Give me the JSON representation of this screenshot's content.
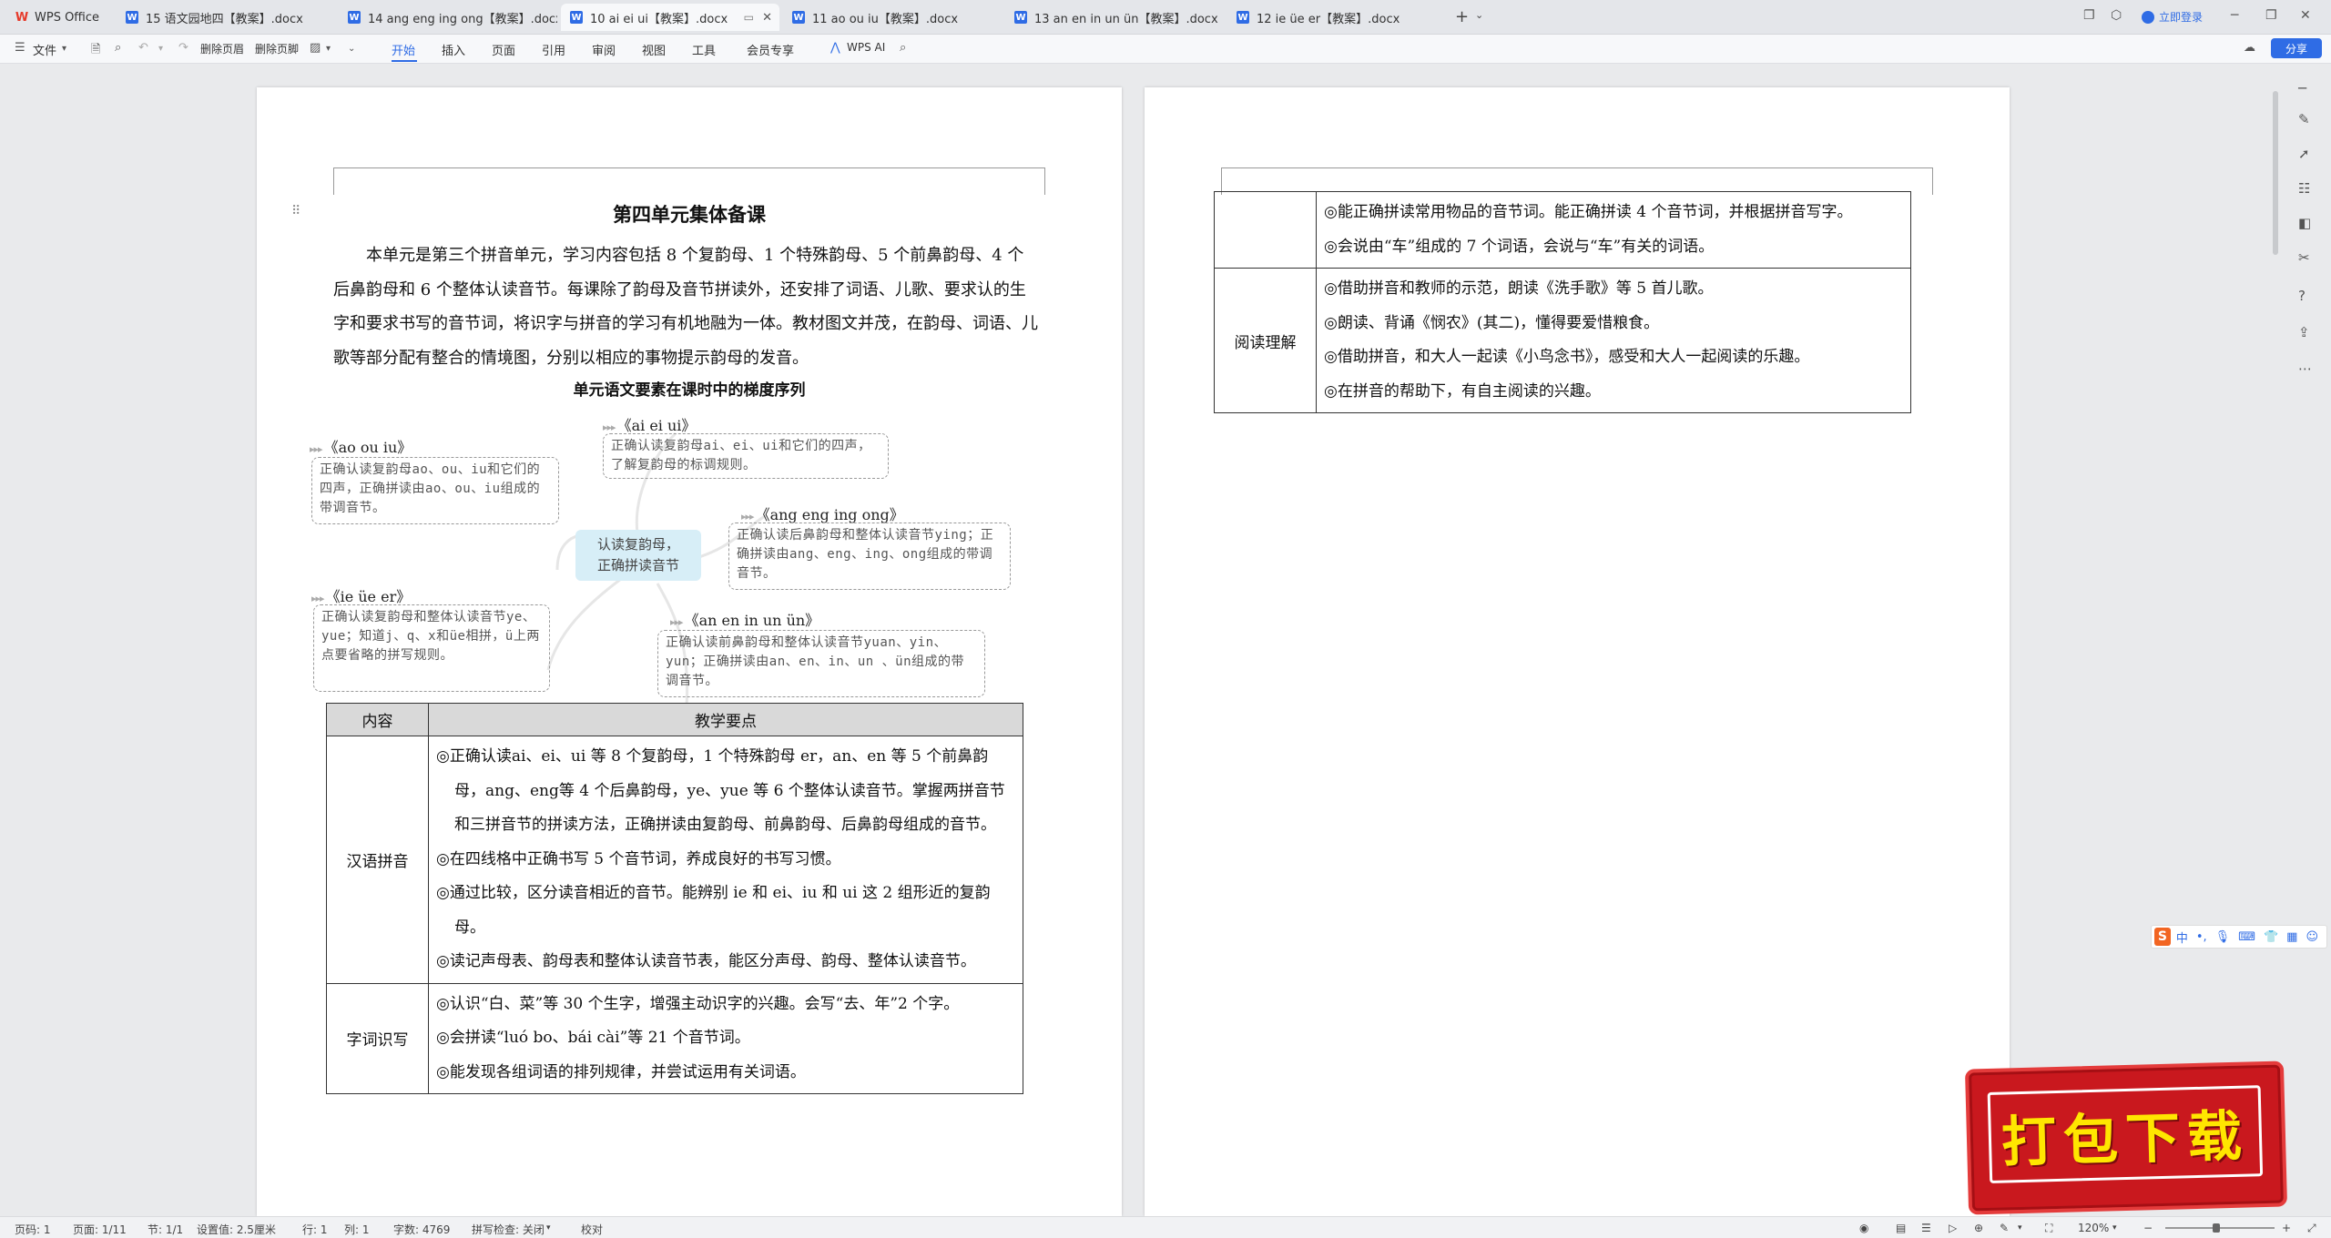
{
  "tabs": [
    {
      "label": "WPS Office"
    },
    {
      "label": "15 语文园地四【教案】.docx"
    },
    {
      "label": "14 ang eng ing ong【教案】.docx"
    },
    {
      "label": "10 ai ei ui【教案】.docx"
    },
    {
      "label": "11 ao ou iu【教案】.docx"
    },
    {
      "label": "13 an en in un ün【教案】.docx"
    },
    {
      "label": "12 ie üe er【教案】.docx"
    }
  ],
  "titlebar": {
    "login": "立即登录"
  },
  "toolbar": {
    "file": "文件",
    "delete_header": "删除页眉",
    "delete_footer": "删除页脚",
    "menus": [
      "开始",
      "插入",
      "页面",
      "引用",
      "审阅",
      "视图",
      "工具",
      "会员专享"
    ],
    "wps_ai": "WPS AI",
    "share": "分享"
  },
  "document": {
    "title": "第四单元集体备课",
    "intro": "本单元是第三个拼音单元，学习内容包括 8 个复韵母、1 个特殊韵母、5 个前鼻韵母、4 个后鼻韵母和 6 个整体认读音节。每课除了韵母及音节拼读外，还安排了词语、儿歌、要求认的生字和要求书写的音节词，将识字与拼音的学习有机地融为一体。教材图文并茂，在韵母、词语、儿歌等部分配有整合的情境图，分别以相应的事物提示韵母的发音。",
    "subtitle": "单元语文要素在课时中的梯度序列",
    "mindmap": {
      "center": [
        "认读复韵母，",
        "正确拼读音节"
      ],
      "nodes": [
        {
          "title": "《ao ou iu》",
          "text": "正确认读复韵母ao、ou、iu和它们的四声，正确拼读由ao、ou、iu组成的带调音节。"
        },
        {
          "title": "《ai ei ui》",
          "text": "正确认读复韵母ai、ei、ui和它们的四声，了解复韵母的标调规则。"
        },
        {
          "title": "《ang eng ing ong》",
          "text": "正确认读后鼻韵母和整体认读音节ying；正确拼读由ang、eng、ing、ong组成的带调音节。"
        },
        {
          "title": "《ie üe er》",
          "text": "正确认读复韵母和整体认读音节ye、yue；知道j、q、x和üe相拼，ü上两点要省略的拼写规则。"
        },
        {
          "title": "《an en in un ün》",
          "text": "正确认读前鼻韵母和整体认读音节yuan、yin、yun；正确拼读由an、en、in、un 、ün组成的带调音节。"
        }
      ]
    },
    "table": {
      "headers": [
        "内容",
        "教学要点"
      ],
      "rows": [
        {
          "category": "汉语拼音",
          "items": [
            "◎正确认读ai、ei、ui 等 8 个复韵母，1 个特殊韵母 er，an、en 等 5 个前鼻韵母，ang、eng等 4 个后鼻韵母，ye、yue 等 6 个整体认读音节。掌握两拼音节和三拼音节的拼读方法，正确拼读由复韵母、前鼻韵母、后鼻韵母组成的音节。",
            "◎在四线格中正确书写 5 个音节词，养成良好的书写习惯。",
            "◎通过比较，区分读音相近的音节。能辨别 ie 和 ei、iu 和 ui 这 2 组形近的复韵母。",
            "◎读记声母表、韵母表和整体认读音节表，能区分声母、韵母、整体认读音节。"
          ]
        },
        {
          "category": "字词识写",
          "items": [
            "◎认识“白、菜”等 30 个生字，增强主动识字的兴趣。会写“去、年”2 个字。",
            "◎会拼读“luó bo、bái cài”等 21 个音节词。",
            "◎能发现各组词语的排列规律，并尝试运用有关词语。"
          ]
        }
      ]
    },
    "table2": {
      "rows": [
        {
          "category": "",
          "items": [
            "◎能正确拼读常用物品的音节词。能正确拼读 4 个音节词，并根据拼音写字。",
            "◎会说由“车”组成的 7 个词语，会说与“车”有关的词语。"
          ]
        },
        {
          "category": "阅读理解",
          "items": [
            "◎借助拼音和教师的示范，朗读《洗手歌》等 5 首儿歌。",
            "◎朗读、背诵《悯农》(其二)，懂得要爱惜粮食。",
            "◎借助拼音，和大人一起读《小鸟念书》，感受和大人一起阅读的乐趣。",
            "◎在拼音的帮助下，有自主阅读的兴趣。"
          ]
        }
      ]
    }
  },
  "ime": {
    "label": "中"
  },
  "promo": {
    "text": "打包下载"
  },
  "statusbar": {
    "page_num": "页码: 1",
    "page_of": "页面: 1/11",
    "section": "节: 1/1",
    "setting": "设置值: 2.5厘米",
    "row": "行: 1",
    "col": "列: 1",
    "word_count": "字数: 4769",
    "spell": "拼写检查: 关闭",
    "proof": "校对",
    "zoom": "120%"
  },
  "colors": {
    "accent": "#2f6ce5",
    "mindmap_center": "#d7eef7",
    "table_header": "#d9d9d9",
    "promo_bg": "#c9181e",
    "promo_text": "#ffe600"
  }
}
